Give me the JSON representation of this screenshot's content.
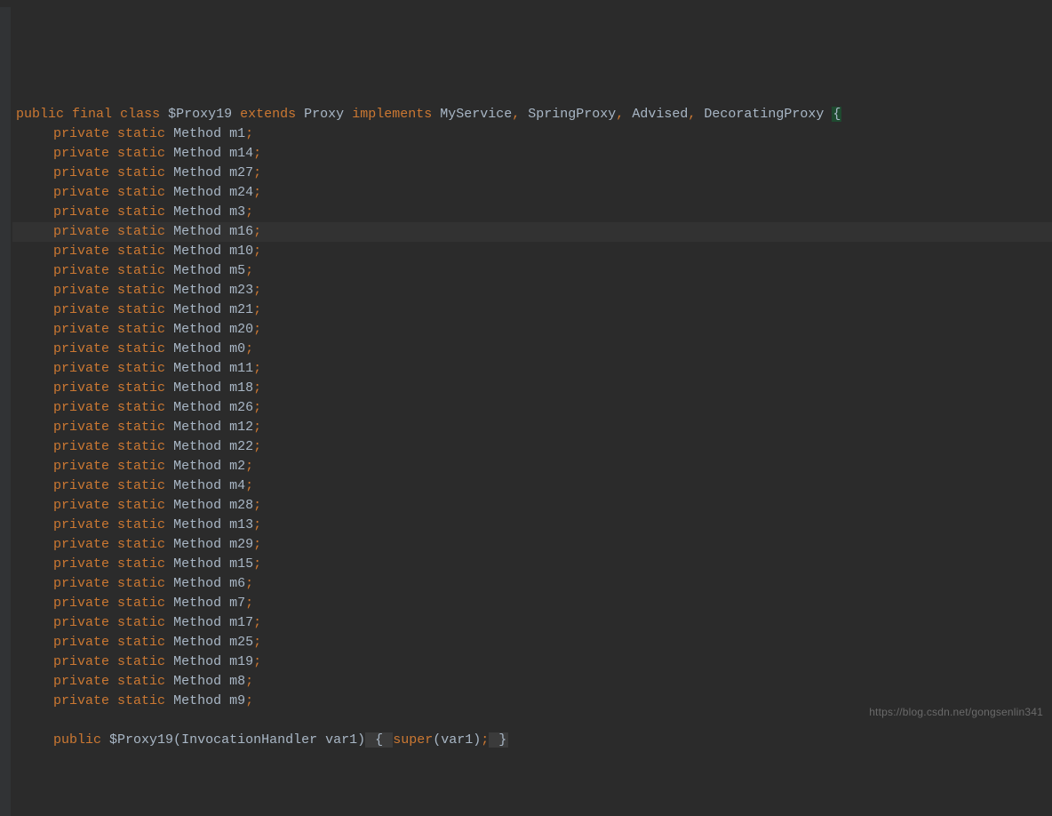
{
  "code": {
    "classDecl": {
      "public": "public",
      "final": "final",
      "class": "class",
      "name": "$Proxy19",
      "extends": "extends",
      "parent": "Proxy",
      "implements": "implements",
      "iface1": "MyService",
      "iface2": "SpringProxy",
      "iface3": "Advised",
      "iface4": "DecoratingProxy",
      "openBrace": "{"
    },
    "fields": [
      {
        "priv": "private",
        "stat": "static",
        "type": "Method",
        "name": "m1",
        "semi": ";"
      },
      {
        "priv": "private",
        "stat": "static",
        "type": "Method",
        "name": "m14",
        "semi": ";"
      },
      {
        "priv": "private",
        "stat": "static",
        "type": "Method",
        "name": "m27",
        "semi": ";"
      },
      {
        "priv": "private",
        "stat": "static",
        "type": "Method",
        "name": "m24",
        "semi": ";"
      },
      {
        "priv": "private",
        "stat": "static",
        "type": "Method",
        "name": "m3",
        "semi": ";"
      },
      {
        "priv": "private",
        "stat": "static",
        "type": "Method",
        "name": "m16",
        "semi": ";",
        "highlight": true
      },
      {
        "priv": "private",
        "stat": "static",
        "type": "Method",
        "name": "m10",
        "semi": ";"
      },
      {
        "priv": "private",
        "stat": "static",
        "type": "Method",
        "name": "m5",
        "semi": ";"
      },
      {
        "priv": "private",
        "stat": "static",
        "type": "Method",
        "name": "m23",
        "semi": ";"
      },
      {
        "priv": "private",
        "stat": "static",
        "type": "Method",
        "name": "m21",
        "semi": ";"
      },
      {
        "priv": "private",
        "stat": "static",
        "type": "Method",
        "name": "m20",
        "semi": ";"
      },
      {
        "priv": "private",
        "stat": "static",
        "type": "Method",
        "name": "m0",
        "semi": ";"
      },
      {
        "priv": "private",
        "stat": "static",
        "type": "Method",
        "name": "m11",
        "semi": ";"
      },
      {
        "priv": "private",
        "stat": "static",
        "type": "Method",
        "name": "m18",
        "semi": ";"
      },
      {
        "priv": "private",
        "stat": "static",
        "type": "Method",
        "name": "m26",
        "semi": ";"
      },
      {
        "priv": "private",
        "stat": "static",
        "type": "Method",
        "name": "m12",
        "semi": ";"
      },
      {
        "priv": "private",
        "stat": "static",
        "type": "Method",
        "name": "m22",
        "semi": ";"
      },
      {
        "priv": "private",
        "stat": "static",
        "type": "Method",
        "name": "m2",
        "semi": ";"
      },
      {
        "priv": "private",
        "stat": "static",
        "type": "Method",
        "name": "m4",
        "semi": ";"
      },
      {
        "priv": "private",
        "stat": "static",
        "type": "Method",
        "name": "m28",
        "semi": ";"
      },
      {
        "priv": "private",
        "stat": "static",
        "type": "Method",
        "name": "m13",
        "semi": ";"
      },
      {
        "priv": "private",
        "stat": "static",
        "type": "Method",
        "name": "m29",
        "semi": ";"
      },
      {
        "priv": "private",
        "stat": "static",
        "type": "Method",
        "name": "m15",
        "semi": ";"
      },
      {
        "priv": "private",
        "stat": "static",
        "type": "Method",
        "name": "m6",
        "semi": ";"
      },
      {
        "priv": "private",
        "stat": "static",
        "type": "Method",
        "name": "m7",
        "semi": ";"
      },
      {
        "priv": "private",
        "stat": "static",
        "type": "Method",
        "name": "m17",
        "semi": ";"
      },
      {
        "priv": "private",
        "stat": "static",
        "type": "Method",
        "name": "m25",
        "semi": ";"
      },
      {
        "priv": "private",
        "stat": "static",
        "type": "Method",
        "name": "m19",
        "semi": ";"
      },
      {
        "priv": "private",
        "stat": "static",
        "type": "Method",
        "name": "m8",
        "semi": ";"
      },
      {
        "priv": "private",
        "stat": "static",
        "type": "Method",
        "name": "m9",
        "semi": ";"
      }
    ],
    "ctor": {
      "public": "public",
      "name": "$Proxy19",
      "paramType": "InvocationHandler",
      "paramName": "var1",
      "open": "{",
      "super": "super",
      "arg": "var1",
      "semi": ";",
      "close": "}"
    }
  },
  "watermark": "https://blog.csdn.net/gongsenlin341"
}
